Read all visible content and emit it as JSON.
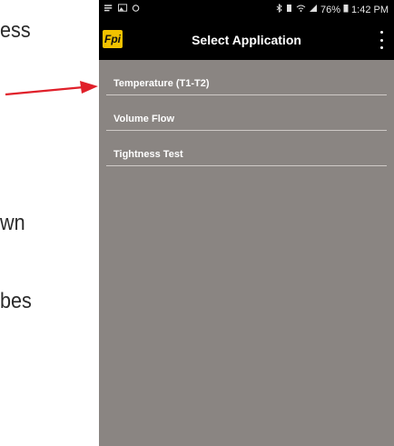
{
  "doc": {
    "line1": "ess",
    "line2": "wn",
    "line3": "bes"
  },
  "statusbar": {
    "battery": "76%",
    "time": "1:42 PM"
  },
  "appbar": {
    "logo": "Fpi",
    "title": "Select Application"
  },
  "menu": {
    "items": [
      {
        "label": "Temperature (T1-T2)"
      },
      {
        "label": "Volume Flow"
      },
      {
        "label": "Tightness Test"
      }
    ]
  },
  "colors": {
    "screen_bg": "#8a8582",
    "bar_bg": "#000000",
    "arrow": "#e0202a",
    "logo_bg": "#f2c200"
  },
  "icons": {
    "annotation": "arrow-right-icon",
    "menu": "more-vert-icon"
  }
}
